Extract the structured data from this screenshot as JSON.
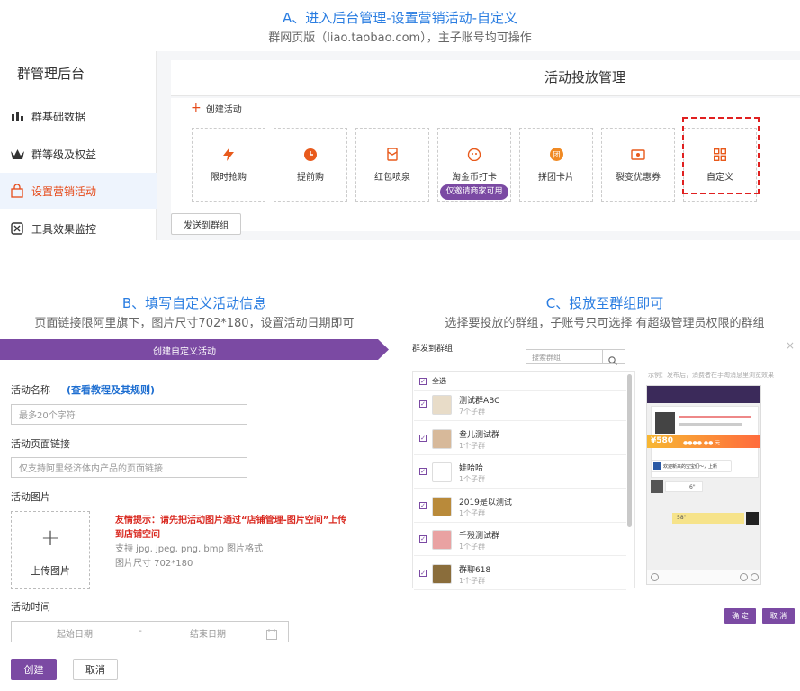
{
  "sectionA": {
    "heading": "A、进入后台管理-设置营销活动-自定义",
    "subheading": "群网页版（liao.taobao.com），主子账号均可操作",
    "sidebar": {
      "title": "群管理后台",
      "items": [
        {
          "label": "群基础数据",
          "icon": "bar-chart-icon"
        },
        {
          "label": "群等级及权益",
          "icon": "crown-icon"
        },
        {
          "label": "设置营销活动",
          "icon": "shopping-bag-icon"
        },
        {
          "label": "工具效果监控",
          "icon": "monitor-icon"
        }
      ]
    },
    "main": {
      "title": "活动投放管理",
      "create_label": "创建活动",
      "tools": [
        {
          "label": "限时抢购",
          "icon": "lightning-icon"
        },
        {
          "label": "提前购",
          "icon": "clock-icon"
        },
        {
          "label": "红包喷泉",
          "icon": "red-envelope-icon"
        },
        {
          "label": "淘金币打卡",
          "icon": "coin-icon"
        },
        {
          "label": "拼团卡片",
          "icon": "group-card-icon"
        },
        {
          "label": "裂变优惠券",
          "icon": "coupon-icon"
        },
        {
          "label": "自定义",
          "icon": "grid-icon"
        }
      ],
      "invite_badge": "仅邀请商家可用",
      "send_button": "发送到群组"
    }
  },
  "sectionB": {
    "heading": "B、填写自定义活动信息",
    "subheading": "页面链接限阿里旗下，图片尺寸702*180，设置活动日期即可",
    "banner_title": "创建自定义活动",
    "name_label": "活动名称",
    "rules_link": "(查看教程及其规则)",
    "name_placeholder": "最多20个字符",
    "link_label": "活动页面链接",
    "link_placeholder": "仅支持阿里经济体内产品的页面链接",
    "image_label": "活动图片",
    "upload_label": "上传图片",
    "tip_line1": "友情提示：请先把活动图片通过“店铺管理-图片空间”上传",
    "tip_line2": "到店铺空间",
    "format_hint": "支持 jpg, jpeg, png, bmp 图片格式",
    "size_hint": "图片尺寸 702*180",
    "time_label": "活动时间",
    "start_placeholder": "起始日期",
    "date_sep": "-",
    "end_placeholder": "结束日期",
    "create_button": "创建",
    "cancel_button": "取消"
  },
  "sectionC": {
    "heading": "C、投放至群组即可",
    "subheading": "选择要投放的群组，子账号只可选择 有超级管理员权限的群组",
    "dialog_title": "群发到群组",
    "search_placeholder": "搜索群组",
    "select_all": "全选",
    "preview_hint": "示例：发布后，消费者在手淘消息里浏览效果",
    "groups": [
      {
        "name": "测试群ABC",
        "sub": "7个子群"
      },
      {
        "name": "叁儿测试群",
        "sub": "1个子群"
      },
      {
        "name": "娃哈哈",
        "sub": "1个子群"
      },
      {
        "name": "2019是以测试",
        "sub": "1个子群"
      },
      {
        "name": "千殁测试群",
        "sub": "1个子群"
      },
      {
        "name": "群聊618",
        "sub": "1个子群"
      }
    ],
    "phone": {
      "price": "¥580",
      "price_suffix": "●●●● ●● 元",
      "welcome": "欢迎新来的宝宝们～，上新",
      "voice_len": "6\"",
      "voice_len2": "58\""
    },
    "confirm_button": "确 定",
    "cancel_button": "取 消"
  },
  "colors": {
    "accent_blue": "#2a7de1",
    "brand_purple": "#7b4aa3",
    "orange": "#e64a19",
    "tip_red": "#d9281f",
    "dashed_red": "#e02020"
  }
}
